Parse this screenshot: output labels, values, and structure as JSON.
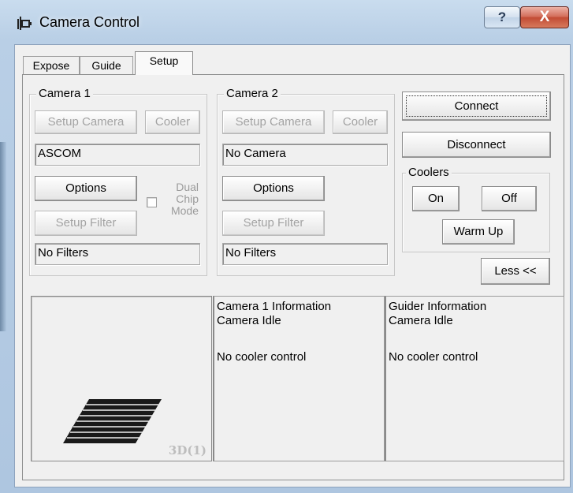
{
  "window": {
    "title": "Camera Control",
    "help_label": "?",
    "close_label": "X"
  },
  "tabs": [
    {
      "label": "Expose",
      "active": false
    },
    {
      "label": "Guide",
      "active": false
    },
    {
      "label": "Setup",
      "active": true
    }
  ],
  "camera1": {
    "group_label": "Camera 1",
    "setup_camera_label": "Setup Camera",
    "cooler_label": "Cooler",
    "camera_value": "ASCOM",
    "options_label": "Options",
    "setup_filter_label": "Setup Filter",
    "filter_value": "No Filters",
    "dual_chip_mode_label": "Dual\nChip\nMode",
    "dual_chip_mode_checked": false
  },
  "camera2": {
    "group_label": "Camera 2",
    "setup_camera_label": "Setup Camera",
    "cooler_label": "Cooler",
    "camera_value": "No Camera",
    "options_label": "Options",
    "setup_filter_label": "Setup Filter",
    "filter_value": "No Filters"
  },
  "connection": {
    "connect_label": "Connect",
    "disconnect_label": "Disconnect"
  },
  "coolers": {
    "group_label": "Coolers",
    "on_label": "On",
    "off_label": "Off",
    "warm_up_label": "Warm Up"
  },
  "less_label": "Less <<",
  "preview": {
    "label": "3D(1)"
  },
  "camera1_info": {
    "line1": "Camera 1 Information",
    "line2": "Camera Idle",
    "line3": "No cooler control"
  },
  "guider_info": {
    "line1": "Guider Information",
    "line2": "Camera Idle",
    "line3": "No cooler control"
  },
  "colors": {
    "title_gradient_top": "#c9dcee",
    "close_button": "#c24c35",
    "dialog_face": "#f0f0f0",
    "disabled_text": "#a3a3a3"
  }
}
